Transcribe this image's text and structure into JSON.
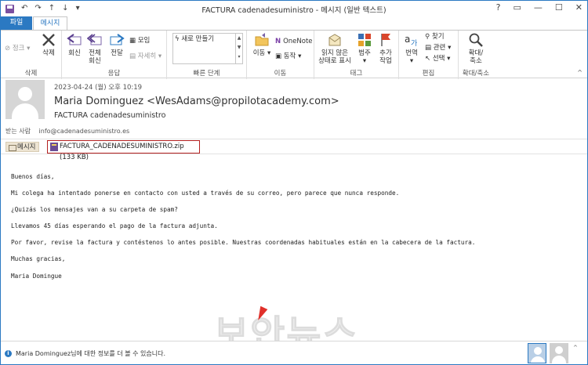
{
  "window": {
    "title": "FACTURA cadenadesuministro - 메시지 (일반 텍스트)",
    "help": "?",
    "restore": "▭",
    "minimize": "—",
    "maximize": "☐",
    "close": "✕"
  },
  "qat": {
    "undo": "↶",
    "redo": "↷",
    "up": "↑",
    "down": "↓",
    "more": "▾"
  },
  "tabs": {
    "file": "파일",
    "message": "메시지"
  },
  "ribbon": {
    "delete_group": {
      "label": "삭제",
      "junk": "정크",
      "delete": "삭제"
    },
    "respond_group": {
      "label": "응답",
      "reply": "회신",
      "reply_all_1": "전체",
      "reply_all_2": "회신",
      "forward": "전달",
      "meeting": "모임",
      "more": "자세히"
    },
    "quicksteps_group": {
      "label": "빠른 단계",
      "item": "새로 만들기"
    },
    "move_group": {
      "label": "이동",
      "move": "이동",
      "onenote": "OneNote",
      "actions": "동작"
    },
    "tags_group": {
      "label": "태그",
      "mark_unread_1": "읽지 않은",
      "mark_unread_2": "상태로 표시",
      "categorize": "범주",
      "follow_up_1": "추가",
      "follow_up_2": "작업"
    },
    "editing_group": {
      "label": "편집",
      "translate": "번역",
      "find": "찾기",
      "related": "관련",
      "select": "선택"
    },
    "zoom_group": {
      "label": "확대/축소",
      "zoom_1": "확대/",
      "zoom_2": "축소"
    }
  },
  "header": {
    "date": "2023-04-24 (월) 오후 10:19",
    "sender": "Maria Dominguez <WesAdams@propilotacademy.com>",
    "subject": "FACTURA cadenadesuministro",
    "to_label": "받는 사람",
    "to_value": "info@cadenadesuministro.es"
  },
  "attachments": {
    "message_tab": "메시지",
    "file": "FACTURA_CADENADESUMINISTRO.zip (133 KB)"
  },
  "body": {
    "lines": [
      "Buenos días,",
      "Mi colega ha intentado ponerse en contacto con usted a través de su correo, pero parece que nunca responde.",
      "¿Quizás los mensajes van a su carpeta de spam?",
      "Llevamos 45 días esperando el pago de la factura adjunta.",
      "Por favor, revise la factura y contéstenos lo antes posible. Nuestras coordenadas habituales están en la cabecera de la factura.",
      "Muchas gracias,",
      "Maria Domingue"
    ]
  },
  "watermark": "보안뉴스",
  "status": {
    "text": "Maria Dominguez님에 대한 정보를 더 볼 수 있습니다."
  },
  "colors": {
    "accent": "#2b79c2",
    "highlight_border": "#b32020"
  }
}
